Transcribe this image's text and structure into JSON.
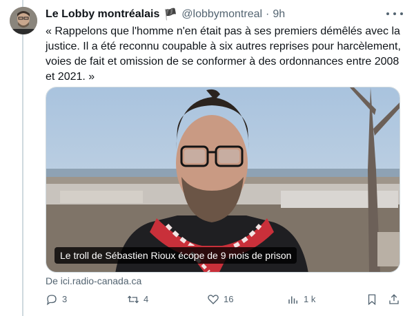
{
  "tweet": {
    "author_name": "Le Lobby montréalais",
    "author_flag": "🏴",
    "handle": "@lobbymontreal",
    "separator": "·",
    "time": "9h",
    "text_lines": [
      "« Rappelons que l'homme n'en était pas à ses premiers démêlés avec la",
      "justice. Il a été reconnu coupable à six autres reprises pour harcèlement,",
      "voies de fait et omission de se conformer à des ordonnances entre 2008",
      "et 2021. »"
    ],
    "card": {
      "caption": "Le troll de Sébastien Rioux écope de 9 mois de prison"
    },
    "source": "De ici.radio-canada.ca",
    "actions": {
      "replies": "3",
      "reposts": "4",
      "likes": "16",
      "views": "1 k"
    }
  },
  "colors": {
    "text": "#0f1419",
    "secondary": "#536471",
    "border": "#cfd9de",
    "sky": "#b7cde3",
    "scarf_red": "#c9303a"
  },
  "icons": [
    "more-icon",
    "reply-icon",
    "repost-icon",
    "like-icon",
    "views-icon",
    "bookmark-icon",
    "share-icon"
  ]
}
